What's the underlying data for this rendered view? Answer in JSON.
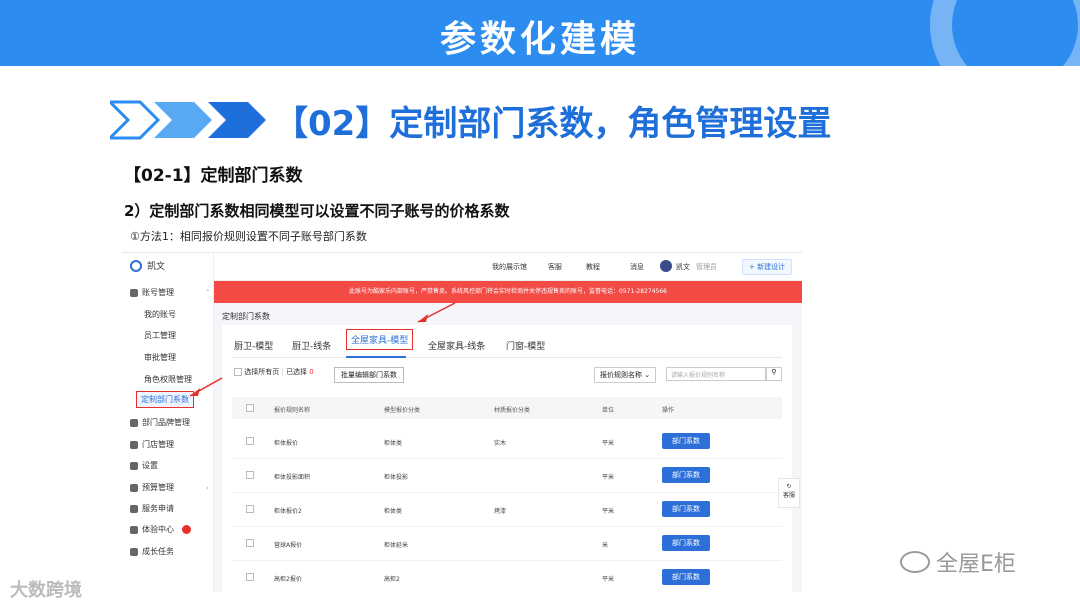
{
  "slide": {
    "banner_title": "参数化建模",
    "heading": "【02】定制部门系数，角色管理设置",
    "sub1": "【02-1】定制部门系数",
    "sub2": "2）定制部门系数相同模型可以设置不同子账号的价格系数",
    "sub3": "①方法1：相同报价规则设置不同子账号部门系数"
  },
  "app": {
    "brand": "凯文",
    "sidebar": {
      "account_mgmt": "账号管理",
      "children": [
        "我的账号",
        "员工管理",
        "审批管理",
        "角色权限管理",
        "定制部门系数"
      ],
      "items": [
        "部门品牌管理",
        "门店管理",
        "设置",
        "预算管理",
        "服务申请",
        "体验中心",
        "成长任务"
      ]
    },
    "topbar": {
      "links": [
        "我的展示馆",
        "客服",
        "教程",
        "消息"
      ],
      "user": "凯文",
      "user_tag": "管理员",
      "new_design": "+ 新建设计"
    },
    "alert": "此账号为酷家乐内部账号，严禁售卖。系统风控部门将会实时检测并关停违规售卖的账号，监督电话：0571-28274566",
    "page_title": "定制部门系数",
    "tabs": [
      "厨卫-模型",
      "厨卫-线条",
      "全屋家具-模型",
      "全屋家具-线条",
      "门窗-模型"
    ],
    "toolbar": {
      "select_all": "选择所有页",
      "selected_label": "已选择",
      "selected_count": "0",
      "batch_button": "批量编辑部门系数",
      "rule_select": "报价规则名称",
      "search_placeholder": "请输入报价规则名称"
    },
    "table": {
      "headers": [
        "报价规则名称",
        "模型报价分类",
        "材质报价分类",
        "单位",
        "操作"
      ],
      "rows": [
        [
          "柜体报价",
          "柜体类",
          "实木",
          "平米",
          "部门系数"
        ],
        [
          "柜体投影面积",
          "柜体投影",
          "",
          "平米",
          "部门系数"
        ],
        [
          "柜体报价2",
          "柜体类",
          "烤漆",
          "平米",
          "部门系数"
        ],
        [
          "营球A报价",
          "柜体延米",
          "",
          "米",
          "部门系数"
        ],
        [
          "高柜2报价",
          "高柜2",
          "",
          "平米",
          "部门系数"
        ]
      ]
    },
    "float_service": "客服"
  },
  "watermarks": {
    "left": "大数跨境",
    "right": "全屋E柜"
  },
  "colors": {
    "banner": "#2d8cf0",
    "heading": "#1e6fd9",
    "accent": "#2d6fd9",
    "alert": "#f24b45",
    "highlight": "#e8302a"
  }
}
